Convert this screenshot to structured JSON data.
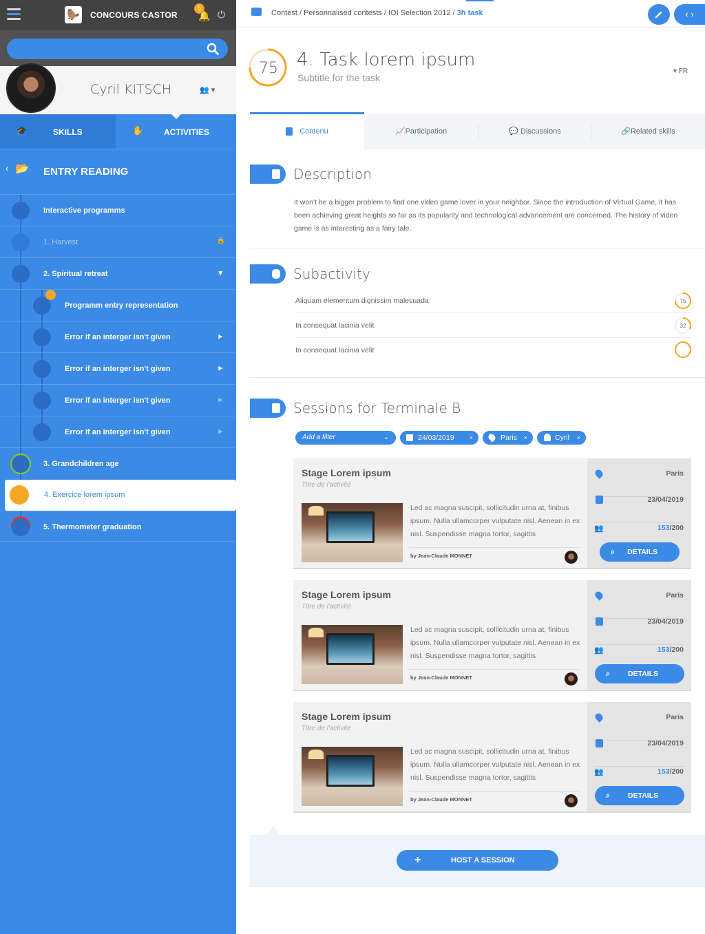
{
  "app": {
    "brand": "CONCOURS CASTOR",
    "notifications": "5"
  },
  "search": {
    "placeholder": ""
  },
  "user": {
    "name": "Cyril KITSCH"
  },
  "sidebar_tabs": {
    "skills": "SKILLS",
    "activities": "ACTIVITIES"
  },
  "entry": {
    "title": "ENTRY READING"
  },
  "tree": [
    {
      "label": "Interactive programms"
    },
    {
      "label": "1. Harvest"
    },
    {
      "label": "2. Spiritual retreat"
    },
    {
      "label": "Programm entry representation"
    },
    {
      "label": "Error if an interger isn't given"
    },
    {
      "label": "Error if an interger isn't given"
    },
    {
      "label": "Error if an interger isn't given"
    },
    {
      "label": "Error if an interger isn't given"
    },
    {
      "label": "3. Grandchildren age"
    },
    {
      "label": "4. Exercice lorem ipsum"
    },
    {
      "label": "5. Thermometer graduation"
    }
  ],
  "breadcrumb": {
    "path": "Contest / Personnalised contests / IOI Selection 2012 /",
    "current": "3h task"
  },
  "task": {
    "score": "75",
    "title": "4. Task lorem ipsum",
    "subtitle": "Subtitle for the task",
    "lang": "FR"
  },
  "content_tabs": [
    "Contenu",
    "Participation",
    "Discussions",
    "Related skills"
  ],
  "description": {
    "title": "Description",
    "text": "It won't be a bigger problem to find one video game lover in your neighbor. Since the introduction of Virtual Game, it has been achieving great heights so far as its popularity and technological advancement are concerned. The history of video game is as interesting as a fairy tale."
  },
  "subactivity": {
    "title": "Subactivity",
    "items": [
      {
        "label": "Aliquam elementum dignissim malesuada",
        "score": "75",
        "progress": 0.75
      },
      {
        "label": "In consequat lacinia velit",
        "score": "32",
        "progress": 0.32
      },
      {
        "label": "In consequat lacinia velit",
        "score": "",
        "progress": 1.0
      }
    ]
  },
  "sessions": {
    "title": "Sessions for Terminale B",
    "filter_placeholder": "Add a filter",
    "chips": [
      "24/03/2019",
      "Paris",
      "Cyril"
    ],
    "cards": [
      {
        "title": "Stage Lorem ipsum",
        "subtitle": "Titre de l'activité",
        "text": "Led ac magna suscipit, sollicitudin urna at, finibus ipsum. Nulla ullamcorper vulputate nisl. Aenean in ex nisl. Suspendisse magna tortor, sagittis",
        "author": "by Jean-Claude MONNET",
        "place": "Paris",
        "date": "23/04/2019",
        "count": "153",
        "capacity": "/200",
        "details": "DETAILS"
      },
      {
        "title": "Stage Lorem ipsum",
        "subtitle": "Titre de l'activité",
        "text": "Led ac magna suscipit, sollicitudin urna at, finibus ipsum. Nulla ullamcorper vulputate nisl. Aenean in ex nisl. Suspendisse magna tortor, sagittis",
        "author": "by Jean-Claude MONNET",
        "place": "Paris",
        "date": "23/04/2019",
        "count": "153",
        "capacity": "/200",
        "details": "DETAILS"
      },
      {
        "title": "Stage Lorem ipsum",
        "subtitle": "Titre de l'activité",
        "text": "Led ac magna suscipit, sollicitudin urna at, finibus ipsum. Nulla ullamcorper vulputate nisl. Aenean in ex nisl. Suspendisse magna tortor, sagittis",
        "author": "by Jean-Claude MONNET",
        "place": "Paris",
        "date": "23/04/2019",
        "count": "153",
        "capacity": "/200",
        "details": "DETAILS"
      }
    ],
    "host_label": "HOST A SESSION"
  },
  "colors": {
    "accent": "#3b8ae6",
    "warning": "#f5a623",
    "sidebar": "#3b8ae6",
    "topbar": "#424242"
  }
}
